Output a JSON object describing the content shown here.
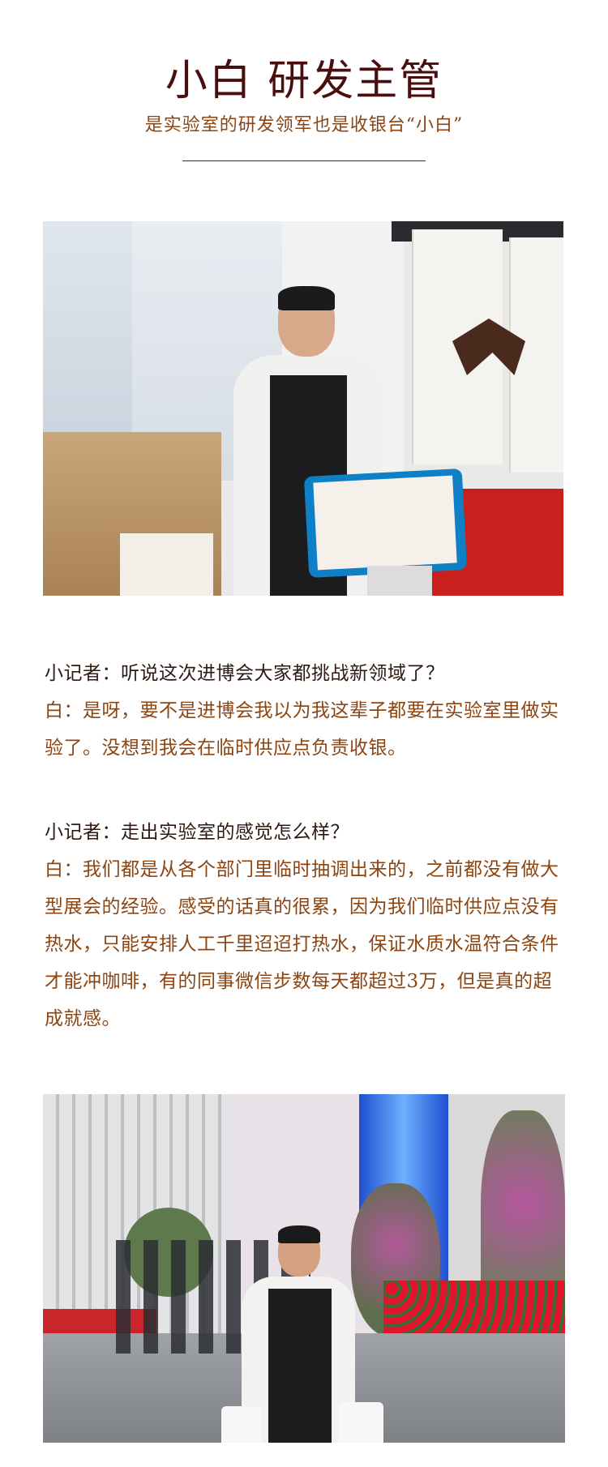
{
  "header": {
    "title": "小白 研发主管",
    "subtitle": "是实验室的研发领军也是收银台“小白”"
  },
  "qa": [
    {
      "question": "小记者：听说这次进博会大家都挑战新领域了？",
      "answer": "白：是呀，要不是进博会我以为我这辈子都要在实验室里做实验了。没想到我会在临时供应点负责收银。"
    },
    {
      "question": "小记者：走出实验室的感觉怎么样？",
      "answer": "白：我们都是从各个部门里临时抽调出来的，之前都没有做大型展会的经验。感受的话真的很累，因为我们临时供应点没有热水，只能安排人工千里迢迢打热水，保证水质水温符合条件才能冲咖啡，有的同事微信步数每天都超过3万，但是真的超成就感。"
    }
  ],
  "colors": {
    "title": "#4a0e0e",
    "subtitle": "#8b4513",
    "question": "#2d1a12",
    "answer": "#8b4513"
  }
}
